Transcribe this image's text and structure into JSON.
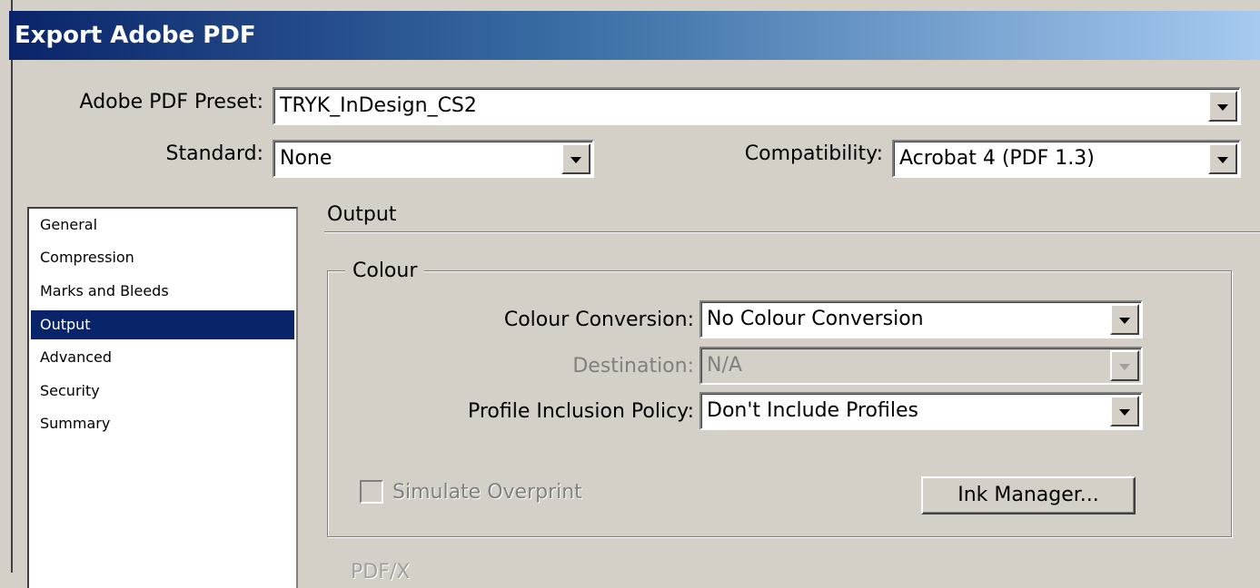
{
  "window": {
    "title": "Export Adobe PDF"
  },
  "preset": {
    "label": "Adobe PDF Preset:",
    "value": "TRYK_InDesign_CS2"
  },
  "standard": {
    "label": "Standard:",
    "value": "None"
  },
  "compatibility": {
    "label": "Compatibility:",
    "value": "Acrobat 4 (PDF 1.3)"
  },
  "sidebar": {
    "items": [
      {
        "label": "General",
        "selected": false
      },
      {
        "label": "Compression",
        "selected": false
      },
      {
        "label": "Marks and Bleeds",
        "selected": false
      },
      {
        "label": "Output",
        "selected": true
      },
      {
        "label": "Advanced",
        "selected": false
      },
      {
        "label": "Security",
        "selected": false
      },
      {
        "label": "Summary",
        "selected": false
      }
    ]
  },
  "panel": {
    "title": "Output",
    "colour": {
      "legend": "Colour",
      "conversion": {
        "label": "Colour Conversion:",
        "value": "No Colour Conversion"
      },
      "destination": {
        "label": "Destination:",
        "value": "N/A",
        "disabled": true
      },
      "profile_policy": {
        "label": "Profile Inclusion Policy:",
        "value": "Don't Include Profiles"
      },
      "simulate_overprint": {
        "label": "Simulate Overprint",
        "checked": false,
        "disabled": true
      },
      "ink_manager_label": "Ink Manager..."
    },
    "pdfx_legend": "PDF/X"
  },
  "colors": {
    "title_gradient_start": "#0a246a",
    "title_gradient_end": "#a6caf0",
    "selection": "#0a246a",
    "face": "#d4d0c8"
  }
}
